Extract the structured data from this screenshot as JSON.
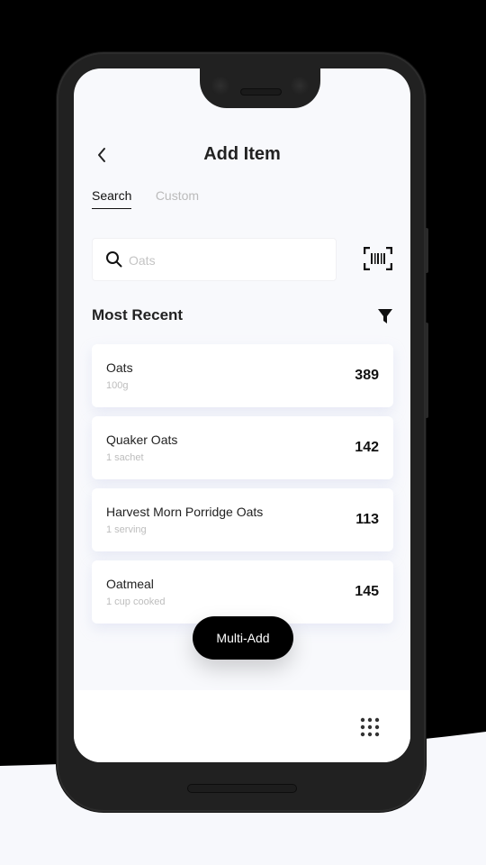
{
  "header": {
    "title": "Add Item",
    "back_icon": "chevron-left-icon"
  },
  "tabs": [
    {
      "label": "Search",
      "active": true
    },
    {
      "label": "Custom",
      "active": false
    }
  ],
  "search": {
    "placeholder": "Oats",
    "value": "",
    "icon": "search-icon",
    "barcode_icon": "barcode-scan-icon"
  },
  "section": {
    "title": "Most Recent",
    "filter_icon": "filter-icon"
  },
  "items": [
    {
      "name": "Oats",
      "serving": "100g",
      "calories": "389"
    },
    {
      "name": "Quaker Oats",
      "serving": "1 sachet",
      "calories": "142"
    },
    {
      "name": "Harvest Morn Porridge Oats",
      "serving": "1 serving",
      "calories": "113"
    },
    {
      "name": "Oatmeal",
      "serving": "1 cup cooked",
      "calories": "145"
    }
  ],
  "multi_add": {
    "label": "Multi-Add"
  },
  "bottom_bar": {
    "menu_icon": "grid-menu-icon"
  },
  "colors": {
    "accent": "#000000",
    "screen_bg": "#f8f9fc",
    "card_bg": "#ffffff",
    "muted_text": "#bdbdbd",
    "device_frame": "#212121"
  }
}
